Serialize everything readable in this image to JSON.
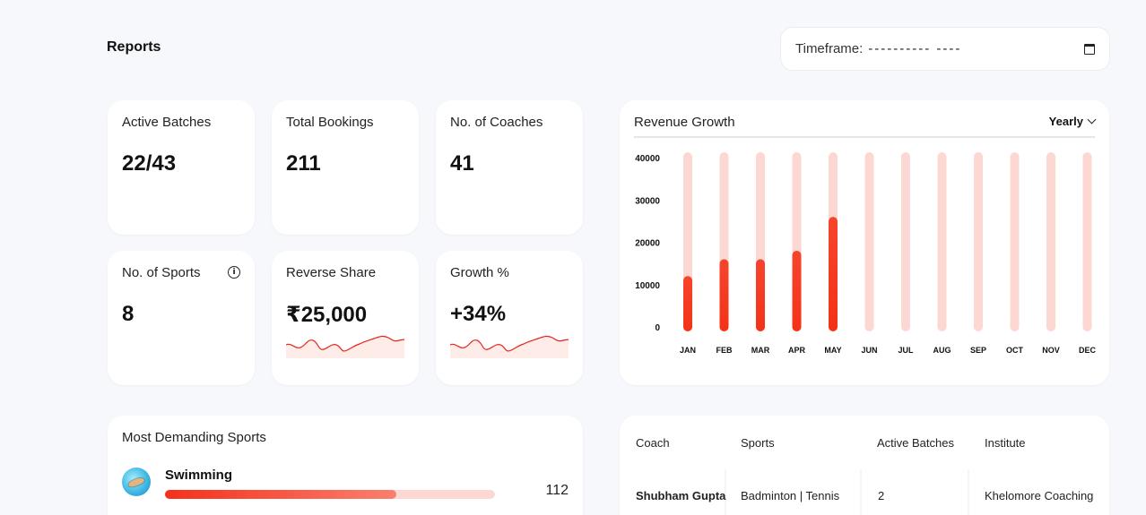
{
  "header": {
    "title": "Reports",
    "timeframe_label": "Timeframe:",
    "timeframe_value": "---------- ----"
  },
  "stats": [
    {
      "label": "Active Batches",
      "value": "22/43"
    },
    {
      "label": "Total Bookings",
      "value": "211"
    },
    {
      "label": "No. of Coaches",
      "value": "41"
    },
    {
      "label": "No. of Sports",
      "value": "8",
      "icon": "info-icon"
    },
    {
      "label": "Reverse Share",
      "value": "₹25,000"
    },
    {
      "label": "Growth %",
      "value": "+34%"
    }
  ],
  "revenue": {
    "title": "Revenue Growth",
    "period": "Yearly",
    "accent": "#f5301a",
    "track_color": "#fdd8d2"
  },
  "chart_data": {
    "type": "bar",
    "title": "Revenue Growth",
    "categories": [
      "JAN",
      "FEB",
      "MAR",
      "APR",
      "MAY",
      "JUN",
      "JUL",
      "AUG",
      "SEP",
      "OCT",
      "NOV",
      "DEC"
    ],
    "values": [
      12000,
      16000,
      16000,
      18000,
      26000,
      0,
      0,
      0,
      0,
      0,
      0,
      0
    ],
    "yticks": [
      "40000",
      "30000",
      "20000",
      "10000",
      "0"
    ],
    "ylim": [
      0,
      42000
    ],
    "grid": false
  },
  "demanding": {
    "title": "Most Demanding Sports",
    "items": [
      {
        "name": "Swimming",
        "count": "112",
        "progress": 0.7
      }
    ]
  },
  "table": {
    "columns": [
      "Coach",
      "Sports",
      "Active Batches",
      "Institute"
    ],
    "rows": [
      {
        "coach": "Shubham Gupta",
        "sports": "Badminton | Tennis",
        "batches": "2",
        "institute": "Khelomore Coaching"
      }
    ]
  }
}
